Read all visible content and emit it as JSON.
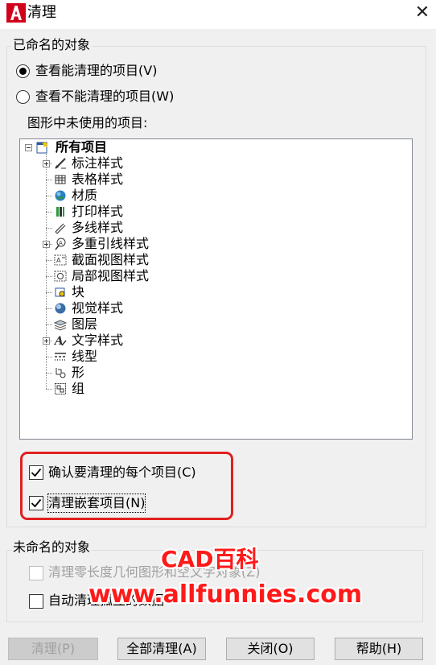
{
  "window": {
    "title": "清理",
    "close_glyph": "✕"
  },
  "named_group": {
    "label": "已命名的对象",
    "option_view_purgeable": "查看能清理的项目(V)",
    "option_view_nonpurgeable": "查看不能清理的项目(W)",
    "tree_caption": "图形中未使用的项目:",
    "selected_option": "view_purgeable"
  },
  "tree": {
    "root": {
      "label": "所有项目",
      "icon": "all-items-icon",
      "expanded": true
    },
    "items": [
      {
        "label": "标注样式",
        "icon": "dimension-style-icon",
        "expandable": true
      },
      {
        "label": "表格样式",
        "icon": "table-style-icon",
        "expandable": false
      },
      {
        "label": "材质",
        "icon": "material-icon",
        "expandable": false
      },
      {
        "label": "打印样式",
        "icon": "plot-style-icon",
        "expandable": false
      },
      {
        "label": "多线样式",
        "icon": "multiline-style-icon",
        "expandable": false
      },
      {
        "label": "多重引线样式",
        "icon": "multileader-style-icon",
        "expandable": true
      },
      {
        "label": "截面视图样式",
        "icon": "section-view-style-icon",
        "expandable": false
      },
      {
        "label": "局部视图样式",
        "icon": "detail-view-style-icon",
        "expandable": false
      },
      {
        "label": "块",
        "icon": "block-icon",
        "expandable": false
      },
      {
        "label": "视觉样式",
        "icon": "visual-style-icon",
        "expandable": false
      },
      {
        "label": "图层",
        "icon": "layer-icon",
        "expandable": false
      },
      {
        "label": "文字样式",
        "icon": "text-style-icon",
        "expandable": true
      },
      {
        "label": "线型",
        "icon": "linetype-icon",
        "expandable": false
      },
      {
        "label": "形",
        "icon": "shape-icon",
        "expandable": false
      },
      {
        "label": "组",
        "icon": "group-icon",
        "expandable": false
      }
    ]
  },
  "checkboxes": {
    "confirm_each": {
      "label": "确认要清理的每个项目(C)",
      "checked": true
    },
    "purge_nested": {
      "label": "清理嵌套项目(N)",
      "checked": true
    }
  },
  "unnamed_group": {
    "label": "未命名的对象",
    "purge_zero_length": {
      "label": "清理零长度几何图形和空文字对象(Z)",
      "checked": false,
      "enabled": false
    },
    "auto_purge": {
      "label": "自动清理孤立的数据",
      "checked": false,
      "enabled": true
    }
  },
  "buttons": {
    "purge": "清理(P)",
    "purge_all": "全部清理(A)",
    "close": "关闭(O)",
    "help": "帮助(H)"
  },
  "watermark": {
    "title": "CAD百科",
    "url": "www.allfunnies.com"
  },
  "colors": {
    "highlight": "#e02020",
    "watermark": "#ff1a1a",
    "app_icon": "#d0021b"
  }
}
